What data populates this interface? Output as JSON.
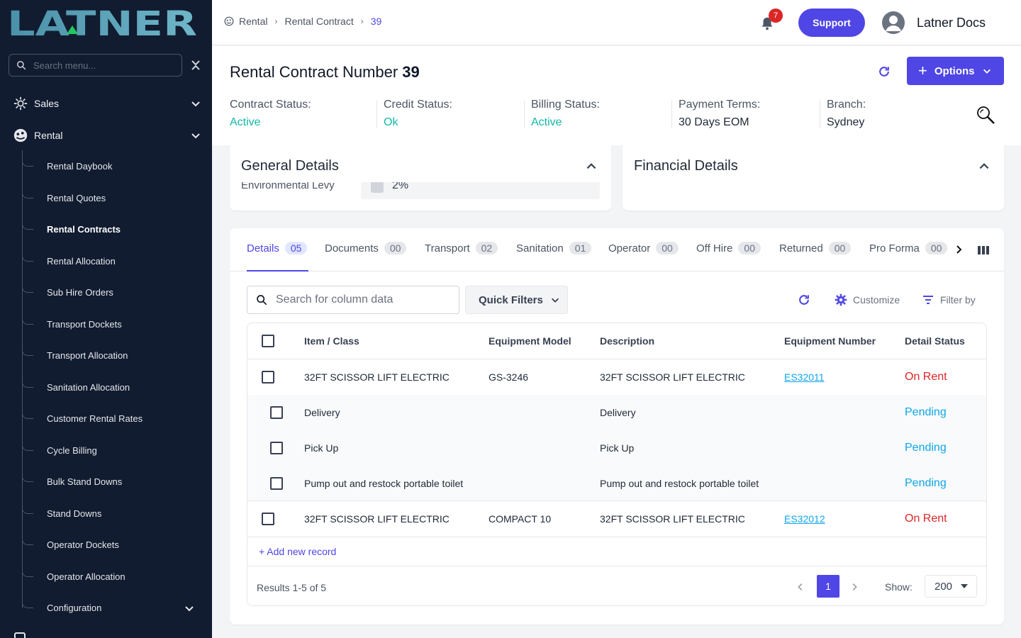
{
  "brand": {
    "logo_text": "LATNER"
  },
  "sidebar": {
    "search_placeholder": "Search menu...",
    "groups": [
      {
        "label": "Sales",
        "icon": "sales-icon"
      },
      {
        "label": "Rental",
        "icon": "rental-icon"
      }
    ],
    "rental_items": [
      "Rental Daybook",
      "Rental Quotes",
      "Rental Contracts",
      "Rental Allocation",
      "Sub Hire Orders",
      "Transport Dockets",
      "Transport Allocation",
      "Sanitation Allocation",
      "Customer Rental Rates",
      "Cycle Billing",
      "Bulk Stand Downs",
      "Stand Downs",
      "Operator Dockets",
      "Operator Allocation",
      "Configuration"
    ],
    "active_item": "Rental Contracts"
  },
  "topbar": {
    "breadcrumb": [
      "Rental",
      "Rental Contract",
      "39"
    ],
    "notification_count": "7",
    "support_label": "Support",
    "user_name": "Latner Docs"
  },
  "header": {
    "title": "Rental Contract Number",
    "number": "39",
    "options_label": "Options",
    "statuses": [
      {
        "label": "Contract Status:",
        "value": "Active",
        "color": "#14b8a6"
      },
      {
        "label": "Credit Status:",
        "value": "Ok",
        "color": "#14b8a6"
      },
      {
        "label": "Billing Status:",
        "value": "Active",
        "color": "#14b8a6"
      },
      {
        "label": "Payment Terms:",
        "value": "30 Days EOM",
        "color": "#1f2937"
      },
      {
        "label": "Branch:",
        "value": "Sydney",
        "color": "#1f2937"
      }
    ]
  },
  "general": {
    "title": "General Details",
    "levy_label": "Environmental Levy",
    "levy_value": "2%"
  },
  "financial": {
    "title": "Financial Details"
  },
  "tabs": [
    {
      "label": "Details",
      "count": "05",
      "active": true
    },
    {
      "label": "Documents",
      "count": "00"
    },
    {
      "label": "Transport",
      "count": "02"
    },
    {
      "label": "Sanitation",
      "count": "01"
    },
    {
      "label": "Operator",
      "count": "00"
    },
    {
      "label": "Off Hire",
      "count": "00"
    },
    {
      "label": "Returned",
      "count": "00"
    },
    {
      "label": "Pro Forma",
      "count": "00"
    }
  ],
  "toolbar": {
    "search_placeholder": "Search for column data",
    "quick_filters": "Quick Filters",
    "customize": "Customize",
    "filter_by": "Filter by"
  },
  "table": {
    "columns": [
      "Item / Class",
      "Equipment Model",
      "Description",
      "Equipment Number",
      "Detail Status"
    ],
    "rows": [
      {
        "item": "32FT SCISSOR LIFT ELECTRIC",
        "model": "GS-3246",
        "desc": "32FT SCISSOR LIFT ELECTRIC",
        "equip": "ES32011",
        "status": "On Rent"
      },
      {
        "item": "Delivery",
        "model": "",
        "desc": "Delivery",
        "equip": "",
        "status": "Pending"
      },
      {
        "item": "Pick Up",
        "model": "",
        "desc": "Pick Up",
        "equip": "",
        "status": "Pending"
      },
      {
        "item": "Pump out and restock portable toilet",
        "model": "",
        "desc": "Pump out and restock portable toilet",
        "equip": "",
        "status": "Pending"
      },
      {
        "item": "32FT SCISSOR LIFT ELECTRIC",
        "model": "COMPACT 10",
        "desc": "32FT SCISSOR LIFT ELECTRIC",
        "equip": "ES32012",
        "status": "On Rent"
      }
    ],
    "add_record": "+ Add new record",
    "results": "Results 1-5 of 5",
    "page": "1",
    "show_label": "Show:",
    "show_value": "200"
  },
  "colors": {
    "accent": "#4f46e5",
    "sidebar": "#111c30",
    "on_rent": "#dc2626",
    "pending": "#0ea5e9",
    "active": "#14b8a6"
  }
}
